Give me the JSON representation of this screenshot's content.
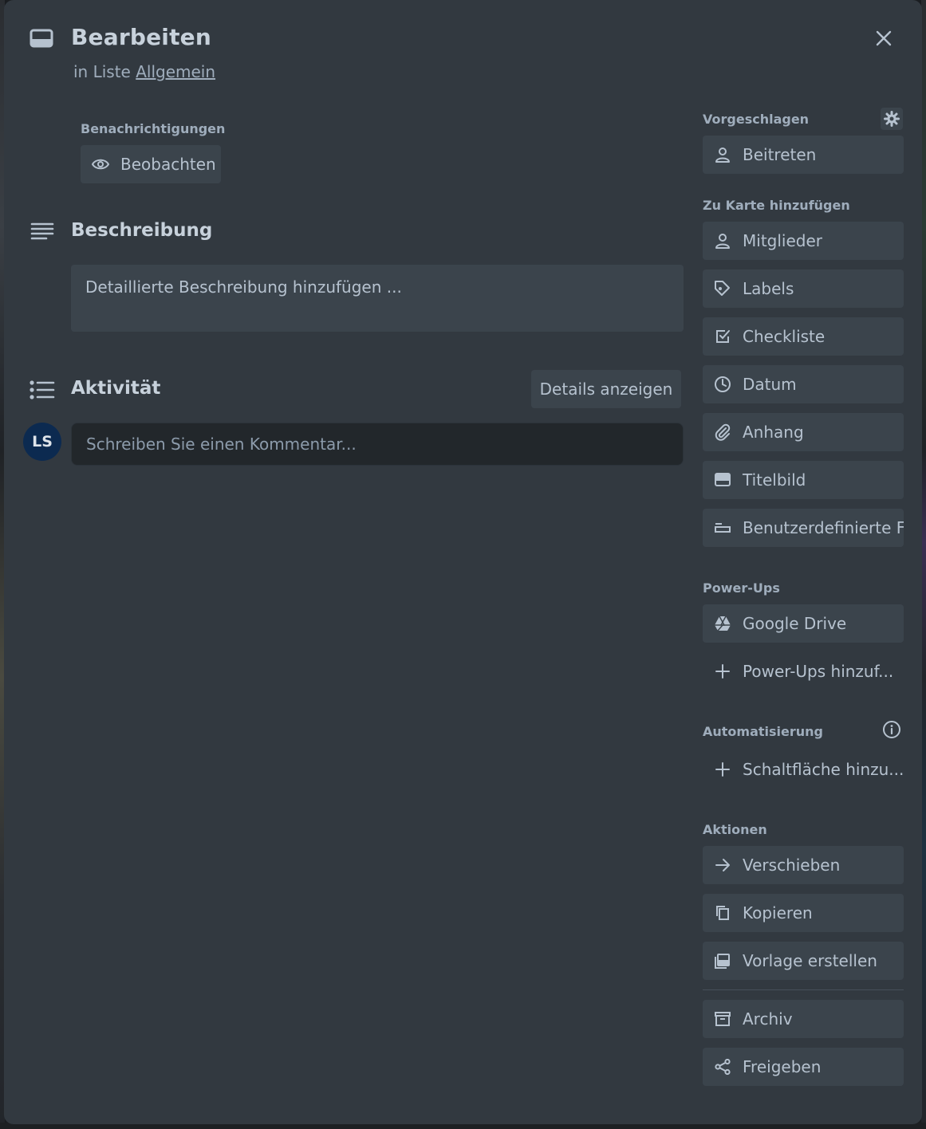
{
  "card": {
    "title": "Bearbeiten",
    "list_prefix": "in Liste",
    "list_name": "Allgemein"
  },
  "notifications": {
    "label": "Benachrichtigungen",
    "watch_button": "Beobachten"
  },
  "description": {
    "heading": "Beschreibung",
    "placeholder": "Detaillierte Beschreibung hinzufügen ..."
  },
  "activity": {
    "heading": "Aktivität",
    "details_button": "Details anzeigen",
    "avatar_initials": "LS",
    "comment_placeholder": "Schreiben Sie einen Kommentar..."
  },
  "sidebar": {
    "suggested": {
      "label": "Vorgeschlagen",
      "join": "Beitreten"
    },
    "add_to_card": {
      "label": "Zu Karte hinzufügen",
      "members": "Mitglieder",
      "labels": "Labels",
      "checklist": "Checkliste",
      "dates": "Datum",
      "attachment": "Anhang",
      "cover": "Titelbild",
      "custom_fields": "Benutzerdefinierte F..."
    },
    "powerups": {
      "label": "Power-Ups",
      "google_drive": "Google Drive",
      "add_powerups": "Power-Ups hinzuf..."
    },
    "automation": {
      "label": "Automatisierung",
      "add_button": "Schaltfläche hinzu..."
    },
    "actions": {
      "label": "Aktionen",
      "move": "Verschieben",
      "copy": "Kopieren",
      "make_template": "Vorlage erstellen",
      "archive": "Archiv",
      "share": "Freigeben"
    }
  },
  "colors": {
    "modal_bg": "#323940",
    "button_bg": "#3b444c",
    "text": "#b6c2cf",
    "avatar_bg": "#0c2a50"
  }
}
